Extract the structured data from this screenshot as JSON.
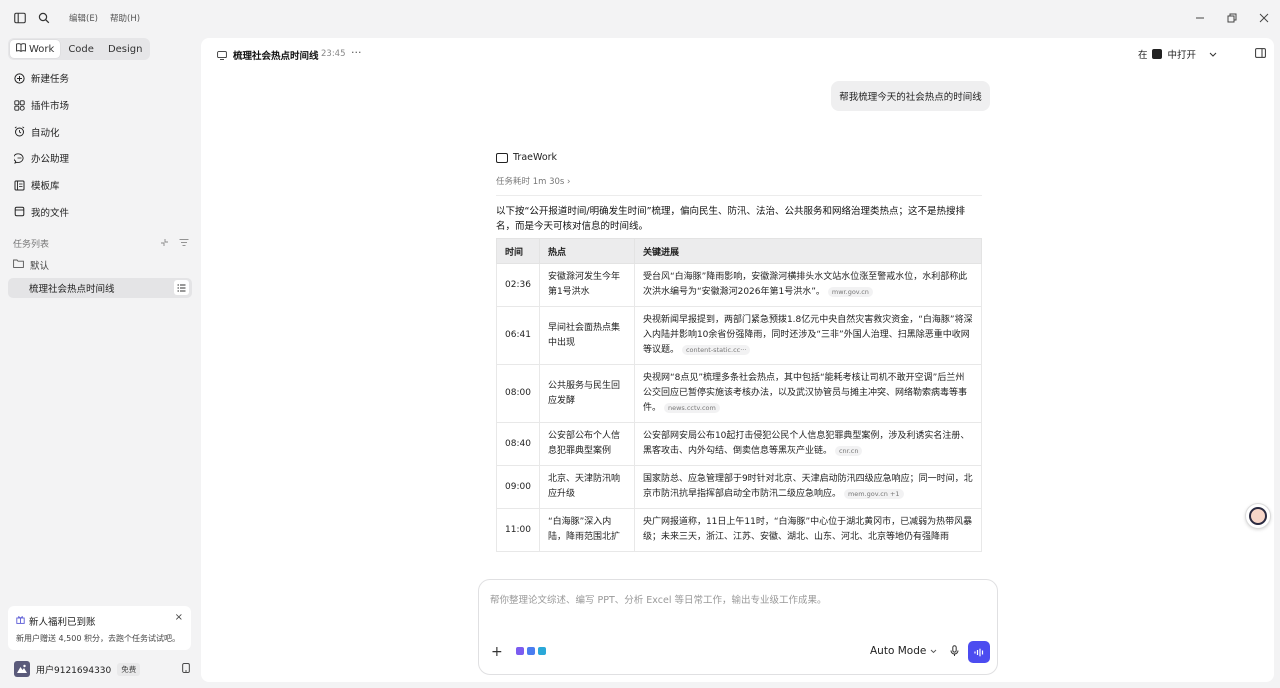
{
  "titlebar": {
    "menu_edit": "编辑(E)",
    "menu_help": "帮助(H)"
  },
  "sidebar": {
    "mode_tabs": [
      {
        "label": "Work",
        "active": true
      },
      {
        "label": "Code",
        "active": false
      },
      {
        "label": "Design",
        "active": false
      }
    ],
    "nav": [
      {
        "label": "新建任务",
        "icon": "new-task-icon"
      },
      {
        "label": "插件市场",
        "icon": "plugin-icon"
      },
      {
        "label": "自动化",
        "icon": "alarm-icon"
      },
      {
        "label": "办公助理",
        "icon": "chat-bubble-icon"
      },
      {
        "label": "模板库",
        "icon": "template-icon"
      },
      {
        "label": "我的文件",
        "icon": "folder-icon"
      }
    ],
    "task_section_label": "任务列表",
    "folder_label": "默认",
    "active_task": "梳理社会热点时间线",
    "promo": {
      "title": "新人福利已到账",
      "text": "新用户赠送 4,500 积分，去跑个任务试试吧。"
    },
    "user": {
      "name": "用户9121694330",
      "badge": "免费"
    }
  },
  "header": {
    "title": "梳理社会热点时间线",
    "time": "23:45",
    "open_side": "在",
    "open_label": "中打开"
  },
  "conversation": {
    "user_message": "帮我梳理今天的社会热点的时间线",
    "agent_name": "TraeWork",
    "duration": "任务耗时 1m 30s",
    "intro": "以下按“公开报道时间/明确发生时间”梳理，偏向民生、防汛、法治、公共服务和网络治理类热点；这不是热搜排名，而是今天可核对信息的时间线。",
    "table": {
      "headers": [
        "时间",
        "热点",
        "关键进展"
      ],
      "rows": [
        {
          "time": "02:36",
          "topic": "安徽滁河发生今年第1号洪水",
          "detail": "受台风“白海豚”降雨影响，安徽滁河横排头水文站水位涨至警戒水位，水利部称此次洪水编号为“安徽滁河2026年第1号洪水”。",
          "source": "mwr.gov.cn"
        },
        {
          "time": "06:41",
          "topic": "早间社会面热点集中出现",
          "detail": "央视新闻早报提到，两部门紧急预拨1.8亿元中央自然灾害救灾资金，“白海豚”将深入内陆并影响10余省份强降雨，同时还涉及“三非”外国人治理、扫黑除恶重中收网等议题。",
          "source": "content-static.cc···"
        },
        {
          "time": "08:00",
          "topic": "公共服务与民生回应发酵",
          "detail": "央视网“8点见”梳理多条社会热点，其中包括“能耗考核让司机不敢开空调”后兰州公交回应已暂停实施该考核办法，以及武汉协管员与摊主冲突、网络勒索病毒等事件。",
          "source": "news.cctv.com"
        },
        {
          "time": "08:40",
          "topic": "公安部公布个人信息犯罪典型案例",
          "detail": "公安部网安局公布10起打击侵犯公民个人信息犯罪典型案例，涉及利诱实名注册、黑客攻击、内外勾结、倒卖信息等黑灰产业链。",
          "source": "cnr.cn"
        },
        {
          "time": "09:00",
          "topic": "北京、天津防汛响应升级",
          "detail": "国家防总、应急管理部于9时针对北京、天津启动防汛四级应急响应；同一时间，北京市防汛抗旱指挥部启动全市防汛二级应急响应。",
          "source": "mem.gov.cn +1"
        },
        {
          "time": "11:00",
          "topic": "“白海豚”深入内陆，降雨范围北扩",
          "detail": "央广网报道称，11日上午11时，“白海豚”中心位于湖北黄冈市，已减弱为热带风暴级；未来三天，浙江、江苏、安徽、湖北、山东、河北、北京等地仍有强降雨",
          "source": ""
        }
      ]
    }
  },
  "composer": {
    "placeholder": "帮你整理论文综述、编写 PPT、分析 Excel 等日常工作，输出专业级工作成果。",
    "mode": "Auto Mode"
  },
  "colors": {
    "accent": "#4c4cf0",
    "panel": "#ffffff",
    "background": "#f3f3f4"
  }
}
